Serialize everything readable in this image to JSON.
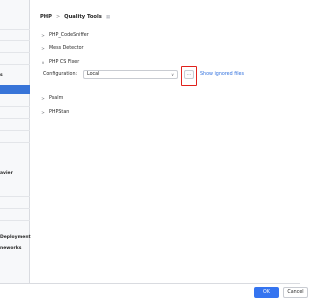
{
  "sidebar": {
    "labels": {
      "s": "s",
      "avier": "avier",
      "deployment": "Deployment",
      "neworks": "neworks"
    }
  },
  "header": {
    "breadcrumb_parent": "PHP",
    "separator": ">",
    "breadcrumb_current": "Quality Tools",
    "pin_icon": "pin-icon"
  },
  "sections": [
    {
      "label": "PHP_CodeSniffer",
      "expanded": false
    },
    {
      "label": "Mess Detector",
      "expanded": false
    },
    {
      "label": "PHP CS Fixer",
      "expanded": true
    },
    {
      "label": "Psalm",
      "expanded": false
    },
    {
      "label": "PHPStan",
      "expanded": false
    }
  ],
  "php_cs_fixer": {
    "configuration_label": "Configuration:",
    "configuration_value": "Local",
    "browse_label": "...",
    "show_ignored_files": "Show ignored files"
  },
  "footer": {
    "ok_label": "OK",
    "cancel_label": "Cancel"
  },
  "colors": {
    "accent": "#3574f0",
    "selected_sidebar": "#3874d8",
    "highlight_box": "#e0221c",
    "link": "#2f6fdd"
  }
}
